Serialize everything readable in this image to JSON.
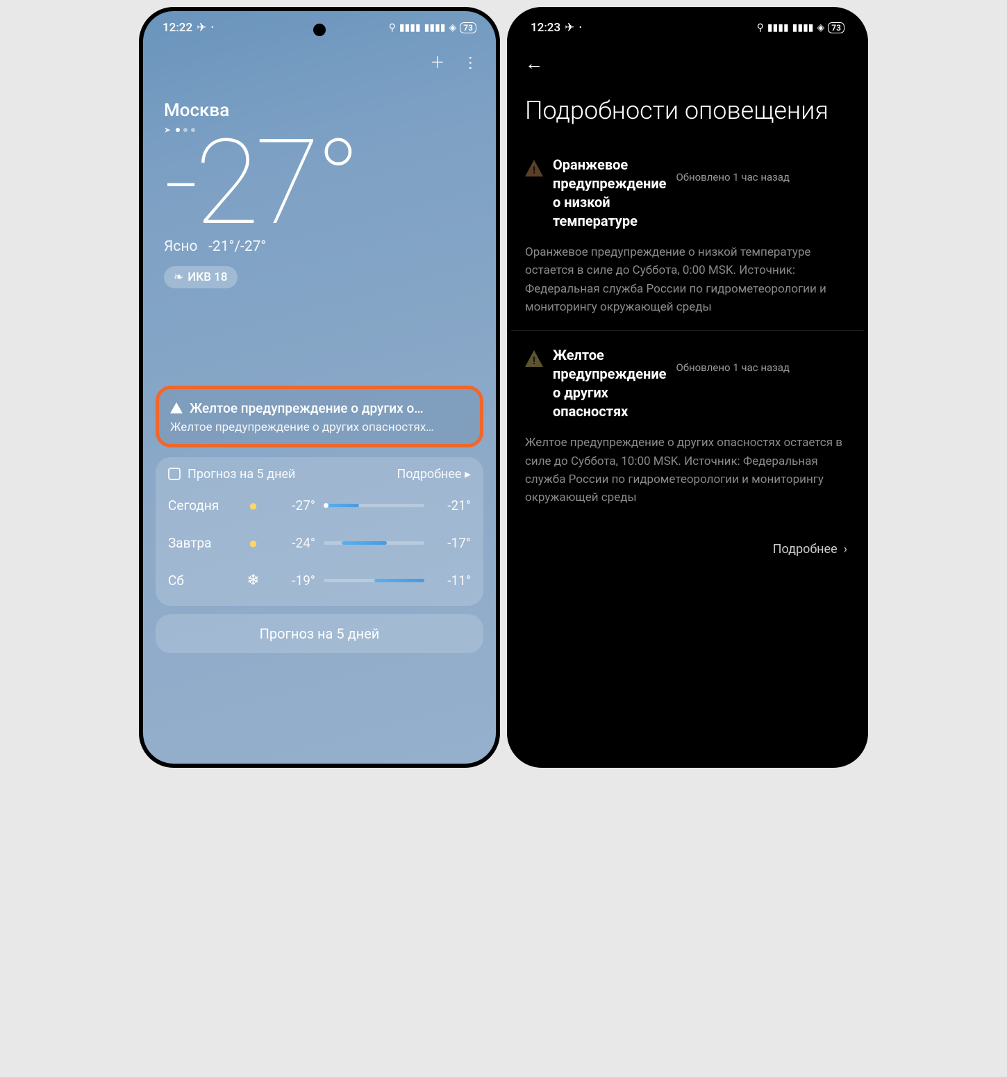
{
  "status": {
    "time_left": "12:22",
    "time_right": "12:23",
    "battery": "73"
  },
  "weather": {
    "city": "Москва",
    "temp": "-27°",
    "condition": "Ясно",
    "high_low": "-21°/-27°",
    "aqi_label": "ИКВ 18"
  },
  "alert_card": {
    "title": "Желтое предупреждение о других о…",
    "subtitle": "Желтое предупреждение о других опасностях…"
  },
  "forecast": {
    "title": "Прогноз на 5 дней",
    "more": "Подробнее",
    "button": "Прогноз на 5 дней",
    "days": [
      {
        "label": "Сегодня",
        "icon": "sun",
        "low": "-27°",
        "high": "-21°"
      },
      {
        "label": "Завтра",
        "icon": "sun",
        "low": "-24°",
        "high": "-17°"
      },
      {
        "label": "Сб",
        "icon": "snow",
        "low": "-19°",
        "high": "-11°"
      }
    ]
  },
  "details": {
    "screen_title": "Подробности оповещения",
    "alerts": [
      {
        "color": "#e88b30",
        "name": "Оранжевое предупреждение о низкой температуре",
        "updated": "Обновлено 1 час назад",
        "body": "Оранжевое предупреждение о низкой температуре остается в силе до Суббота, 0:00 MSK.  Источник: Федеральная служба России по гидрометеорологии и мониторингу окружающей среды"
      },
      {
        "color": "#d6c04a",
        "name": "Желтое предупреждение о других опасностях",
        "updated": "Обновлено 1 час назад",
        "body": "Желтое предупреждение о других опасностях остается в силе до Суббота, 10:00 MSK. Источник: Федеральная служба России по гидрометеорологии и мониторингу окружающей среды"
      }
    ],
    "more": "Подробнее"
  }
}
